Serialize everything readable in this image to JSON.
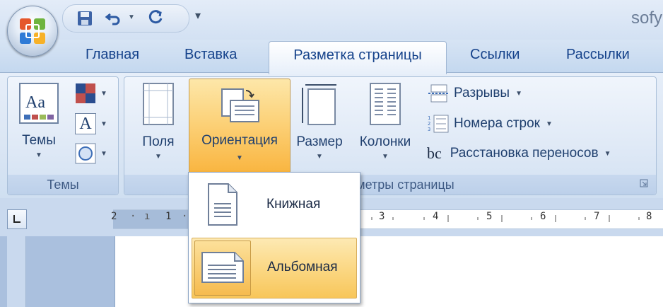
{
  "title_bar": {
    "title": "sofy"
  },
  "quick_access": {
    "save_icon": "save-icon",
    "undo_icon": "undo-icon",
    "redo_icon": "redo-icon",
    "customize_icon": "customize-icon"
  },
  "tabs": [
    {
      "label": "Главная"
    },
    {
      "label": "Вставка"
    },
    {
      "label": "Разметка страницы",
      "active": true
    },
    {
      "label": "Ссылки"
    },
    {
      "label": "Рассылки"
    }
  ],
  "ribbon": {
    "themes_group": {
      "label": "Темы",
      "themes_button": "Темы",
      "themes_icon_text": "Aa",
      "font_icon_text": "A"
    },
    "page_setup_group": {
      "label": "Параметры страницы",
      "margins": "Поля",
      "orientation": "Ориентация",
      "size": "Размер",
      "columns": "Колонки",
      "breaks": "Разрывы",
      "line_numbers": "Номера строк",
      "hyphenation": "Расстановка переносов",
      "hyphenation_icon_text": "bc"
    }
  },
  "orientation_menu": {
    "items": [
      {
        "label": "Книжная"
      },
      {
        "label": "Альбомная",
        "highlighted": true
      }
    ]
  },
  "ruler": {
    "ticks": [
      "2",
      "1",
      "1",
      "3",
      "4",
      "5",
      "6",
      "7",
      "8"
    ]
  },
  "colors": {
    "accent": "#15428b",
    "hover": "#fbd27c",
    "ribbon": "#dbe6f4"
  }
}
